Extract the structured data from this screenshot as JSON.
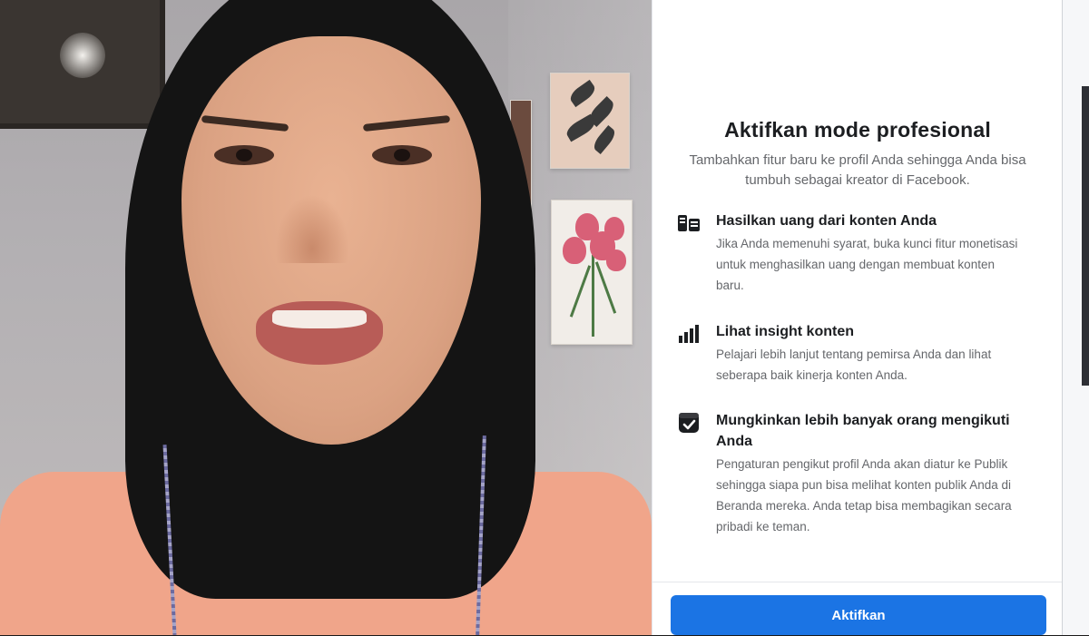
{
  "dialog": {
    "title": "Aktifkan mode profesional",
    "subtitle": "Tambahkan fitur baru ke profil Anda sehingga Anda bisa tumbuh sebagai kreator di Facebook.",
    "features": [
      {
        "icon": "money-icon",
        "title": "Hasilkan uang dari konten Anda",
        "description": "Jika Anda memenuhi syarat, buka kunci fitur monetisasi untuk menghasilkan uang dengan membuat konten baru."
      },
      {
        "icon": "bar-chart-icon",
        "title": "Lihat insight konten",
        "description": "Pelajari lebih lanjut tentang pemirsa Anda dan lihat seberapa baik kinerja konten Anda."
      },
      {
        "icon": "follow-check-icon",
        "title": "Mungkinkan lebih banyak orang mengikuti Anda",
        "description": "Pengaturan pengikut profil Anda akan diatur ke Publik sehingga siapa pun bisa melihat konten publik Anda di Beranda mereka. Anda tetap bisa membagikan secara pribadi ke teman."
      }
    ],
    "button_label": "Aktifkan"
  },
  "colors": {
    "accent": "#1b74e4",
    "title_text": "#1c1e21",
    "secondary_text": "#65676b"
  }
}
